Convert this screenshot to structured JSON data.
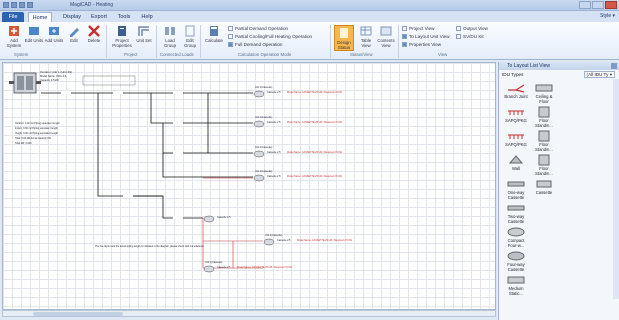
{
  "window": {
    "title": "MagiCAD - Heating"
  },
  "tabs": [
    {
      "label": "File",
      "kind": "file"
    },
    {
      "label": "Home",
      "kind": "active"
    },
    {
      "label": "Display",
      "kind": ""
    },
    {
      "label": "Export",
      "kind": ""
    },
    {
      "label": "Tools",
      "kind": ""
    },
    {
      "label": "Help",
      "kind": ""
    }
  ],
  "style_label": "Style ▾",
  "ribbon": {
    "buttons": [
      {
        "label": "Add System",
        "icon": "add-system-icon",
        "color": "#d05a3a"
      },
      {
        "label": "Edit Units",
        "icon": "edit-units-icon",
        "color": "#4a86c8"
      },
      {
        "label": "Add Units",
        "icon": "add-units-icon",
        "color": "#4a86c8"
      },
      {
        "label": "Edit",
        "icon": "edit-icon",
        "color": "#5a8ac6"
      },
      {
        "label": "Delete",
        "icon": "delete-icon",
        "color": "#c83030"
      },
      {
        "label": "Project Properties",
        "icon": "project-properties-icon",
        "color": "#3e5e8e"
      },
      {
        "label": "Unit Set",
        "icon": "unit-set-icon",
        "color": "#6f87ad"
      },
      {
        "label": "Load Group",
        "icon": "load-group-icon",
        "color": "#8aa0c0"
      },
      {
        "label": "Edit Group",
        "icon": "edit-group-icon",
        "color": "#8aa0c0"
      },
      {
        "label": "Calculate",
        "icon": "calculate-icon",
        "color": "#5a7fb0"
      },
      {
        "label": "Design Status",
        "icon": "design-status-icon",
        "color": "#f2a83a"
      },
      {
        "label": "Table View",
        "icon": "table-view-icon",
        "color": "#7c95bd"
      },
      {
        "label": "Contents View",
        "icon": "contents-view-icon",
        "color": "#7c95bd"
      }
    ],
    "groups": [
      "System",
      "Project",
      "Connected Loads",
      "Calculation Operation Mode",
      "Status/View",
      "View"
    ],
    "checks": [
      {
        "label": "Partial Demand Operation",
        "on": false
      },
      {
        "label": "Partial Cooling/Full Heating Operation",
        "on": false
      },
      {
        "label": "Full Demand Operation",
        "on": true
      },
      {
        "label": "Project View",
        "on": false
      },
      {
        "label": "To Layout Unit View",
        "on": true
      },
      {
        "label": "Properties View",
        "on": true
      },
      {
        "label": "Output View",
        "on": false
      },
      {
        "label": "SV/DU Kit",
        "on": false
      }
    ]
  },
  "panel": {
    "title": "To Layout List View",
    "filter_label": "IDU Types",
    "filter_value": "(All IDU Ty ▾",
    "items": [
      "Branch Joint",
      "Ceiling & Floor",
      "SAPQ/PKG",
      "Floor Standin...",
      "SAPQ/PKG",
      "Floor Standin...",
      "Wall",
      "Floor Standin...",
      "One-way Cassette",
      "Cassette",
      "Two-way Cassette",
      "",
      "Compact Four-w...",
      "",
      "Four-way Cassette",
      "",
      "Medium Static...",
      ""
    ]
  },
  "diagram": {
    "outdoor_unit": {
      "title": "Outdoor Unit 1 (Unit 4S)",
      "lines": [
        "Model Name: ODU 4.5",
        "Capacity 4.5 kW"
      ]
    },
    "legend": [
      "Outdoor: 0.00 m2 Piping equivalent length",
      "Indoor: 0.00 m2 Piping equivalent length",
      "Height: 0.00 m2 Piping equivalent length",
      "Total: 0.00 kW Actual capacity kW",
      "Total kW: 0.000"
    ],
    "idu_label": "Unit 1(Cassette)",
    "idu_model": "Cassette 2.5",
    "idu_spec": "Model Name: CASSETTE-25 kW / Required 2.5 kW",
    "note": "The line layout and the actual piping length is indicated in the diagram, please check with manufacturer."
  }
}
